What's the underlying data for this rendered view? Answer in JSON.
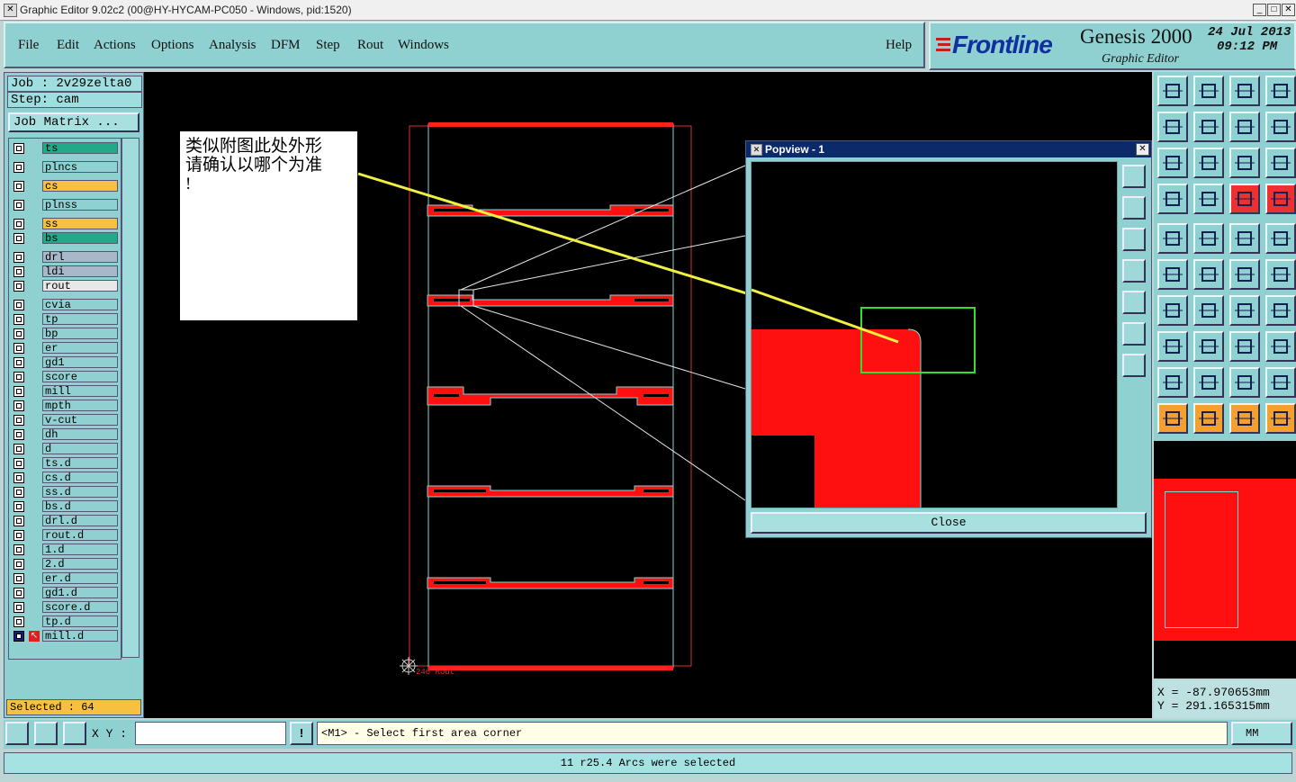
{
  "window": {
    "title": "Graphic Editor 9.02c2 (00@HY-HYCAM-PC050 - Windows, pid:1520)"
  },
  "menu": [
    "File",
    "Edit",
    "Actions",
    "Options",
    "Analysis",
    "DFM",
    "Step",
    "Rout",
    "Windows"
  ],
  "help": "Help",
  "brand": {
    "logo": "Frontline",
    "product": "Genesis 2000",
    "subtitle": "Graphic Editor",
    "date": "24 Jul 2013",
    "time": "09:12 PM"
  },
  "job": {
    "job_label": "Job : 2v29zelta0",
    "step_label": "Step: cam",
    "matrix_button": "Job Matrix ..."
  },
  "layers": [
    {
      "name": "ts",
      "color": "#22aa88"
    },
    {
      "name": "plncs",
      "color": "#8fd0d0"
    },
    {
      "name": "cs",
      "color": "#f6c040"
    },
    {
      "name": "plnss",
      "color": "#8fd0d0"
    },
    {
      "name": "ss",
      "color": "#f6c040"
    },
    {
      "name": "bs",
      "color": "#22aa88"
    },
    {
      "name": "drl",
      "color": "#a8b8c8"
    },
    {
      "name": "ldi",
      "color": "#a8b8c8"
    },
    {
      "name": "rout",
      "color": "#e8e8e8"
    },
    {
      "name": "cvia",
      "color": "#8fd0d0"
    },
    {
      "name": "tp",
      "color": "#8fd0d0"
    },
    {
      "name": "bp",
      "color": "#8fd0d0"
    },
    {
      "name": "er",
      "color": "#8fd0d0"
    },
    {
      "name": "gd1",
      "color": "#8fd0d0"
    },
    {
      "name": "score",
      "color": "#8fd0d0"
    },
    {
      "name": "mill",
      "color": "#8fd0d0"
    },
    {
      "name": "mpth",
      "color": "#8fd0d0"
    },
    {
      "name": "v-cut",
      "color": "#8fd0d0"
    },
    {
      "name": "dh",
      "color": "#8fd0d0"
    },
    {
      "name": "d",
      "color": "#8fd0d0"
    },
    {
      "name": "ts.d",
      "color": "#8fd0d0"
    },
    {
      "name": "cs.d",
      "color": "#8fd0d0"
    },
    {
      "name": "ss.d",
      "color": "#8fd0d0"
    },
    {
      "name": "bs.d",
      "color": "#8fd0d0"
    },
    {
      "name": "drl.d",
      "color": "#8fd0d0"
    },
    {
      "name": "rout.d",
      "color": "#8fd0d0"
    },
    {
      "name": "1.d",
      "color": "#8fd0d0"
    },
    {
      "name": "2.d",
      "color": "#8fd0d0"
    },
    {
      "name": "er.d",
      "color": "#8fd0d0"
    },
    {
      "name": "gd1.d",
      "color": "#8fd0d0"
    },
    {
      "name": "score.d",
      "color": "#8fd0d0"
    },
    {
      "name": "tp.d",
      "color": "#8fd0d0"
    },
    {
      "name": "mill.d",
      "color": "#8fd0d0"
    }
  ],
  "selected": "Selected : 64",
  "annotation": {
    "line1": "类似附图此处外形",
    "line2": "请确认以哪个为准",
    "line3": "!"
  },
  "canvas": {
    "origin_label": "246 Rout"
  },
  "popview": {
    "title": "Popview - 1",
    "close_label": "Close"
  },
  "coords": {
    "x": "X = -87.970653mm",
    "y": "Y = 291.165315mm"
  },
  "bottom": {
    "xy_label": "X Y :",
    "xy_value": "",
    "prompt": "<M1> - Select first area corner",
    "unit": "MM",
    "status": "11 r25.4 Arcs were selected"
  },
  "colors": {
    "canvas_bg": "#000000",
    "feature_red": "#ff0000",
    "outline_cyan": "#7fd8d8",
    "panel": "#8fd0d0"
  }
}
